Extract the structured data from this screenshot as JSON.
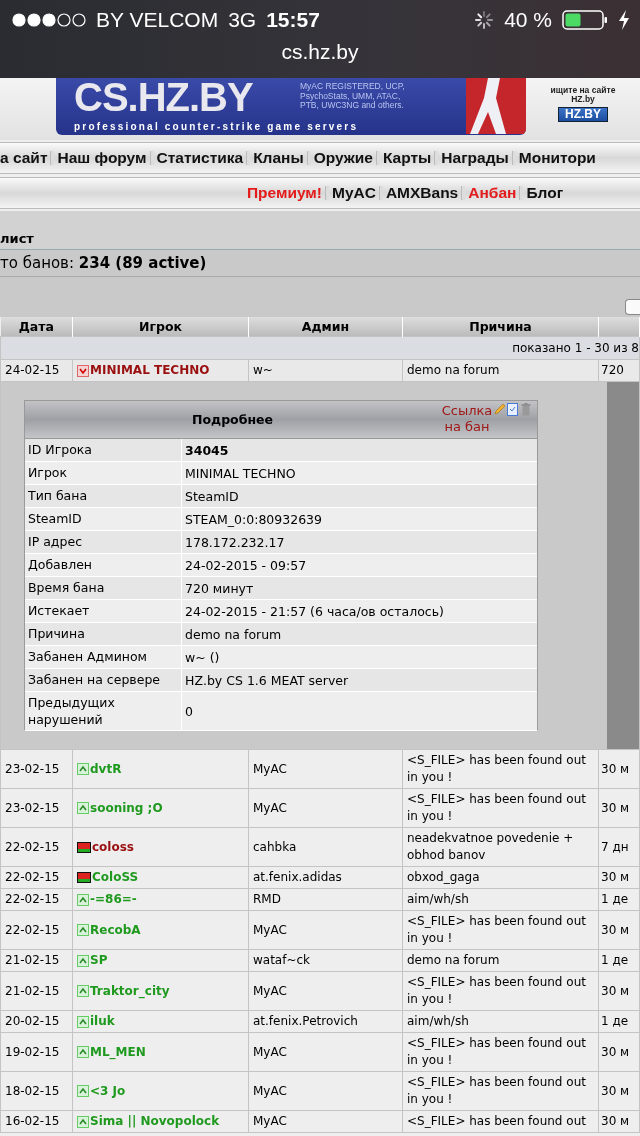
{
  "status_bar": {
    "carrier": "BY VELCOM",
    "network": "3G",
    "time": "15:57",
    "battery": "40 %"
  },
  "address_bar": {
    "url": "cs.hz.by"
  },
  "banner": {
    "logo": "CS.HZ.BY",
    "features": [
      "MyAC REGISTERED, UCP,",
      "PsychoStats, UMM, ATAC,",
      "PTB, UWC3NG and others."
    ],
    "slogan": "professional counter-strike game servers",
    "side_text": [
      "ищите на сайте",
      "HZ.by"
    ],
    "side_logo": "HZ.BY"
  },
  "main_menu": [
    {
      "label": "а сайт"
    },
    {
      "label": "Наш форум"
    },
    {
      "label": "Статистика"
    },
    {
      "label": "Кланы"
    },
    {
      "label": "Оружие"
    },
    {
      "label": "Карты"
    },
    {
      "label": "Награды"
    },
    {
      "label": "Монитори"
    }
  ],
  "sub_menu": [
    {
      "label": "Премиум!",
      "color": "#e31b1b"
    },
    {
      "label": "MyAC",
      "color": "#111111"
    },
    {
      "label": "AMXBans",
      "color": "#111111"
    },
    {
      "label": "Анбан",
      "color": "#e31b1b"
    },
    {
      "label": "Блог",
      "color": "#111111"
    }
  ],
  "section": {
    "title": "лист",
    "total": "то банов: **234 (89 active)**"
  },
  "table": {
    "columns": [
      "Дата",
      "Игрок",
      "Админ",
      "Причина"
    ],
    "pagination": "показано 1 - 30 из 8",
    "rows": [
      {
        "date": "24-02-15",
        "kind": "arrow",
        "player": "MINIMAL TECHNO",
        "color": "#9a1010",
        "admin": "w~",
        "reason": "demo na forum",
        "length": "720",
        "expanded": true
      },
      {
        "date": "23-02-15",
        "kind": "arrow",
        "player": "dvtR",
        "color": "#1f9a1f",
        "admin": "MyAC",
        "reason": "<S_FILE> has been found out in you !",
        "length": "30 м",
        "expanded": false
      },
      {
        "date": "23-02-15",
        "kind": "arrow",
        "player": "sooning ;O",
        "color": "#1f9a1f",
        "admin": "MyAC",
        "reason": "<S_FILE> has been found out in you !",
        "length": "30 м",
        "expanded": false
      },
      {
        "date": "22-02-15",
        "kind": "flag",
        "player": "coloss",
        "color": "#9a1010",
        "admin": "cahbka",
        "reason": "neadekvatnoe povedenie + obhod banov",
        "length": "7 дн"
      },
      {
        "date": "22-02-15",
        "kind": "flag",
        "player": "ColoSS",
        "color": "#1f9a1f",
        "admin": "at.fenix.adidas",
        "reason": "obxod_gaga",
        "length": "30 м"
      },
      {
        "date": "22-02-15",
        "kind": "arrow",
        "player": "-=86=-",
        "color": "#1f9a1f",
        "admin": "RMD",
        "reason": "aim/wh/sh",
        "length": "1 де",
        "expanded": false
      },
      {
        "date": "22-02-15",
        "kind": "arrow",
        "player": "RecobA",
        "color": "#1f9a1f",
        "admin": "MyAC",
        "reason": "<S_FILE> has been found out in you !",
        "length": "30 м",
        "expanded": false
      },
      {
        "date": "21-02-15",
        "kind": "arrow",
        "player": "SP",
        "color": "#1f9a1f",
        "admin": "wataf~ck",
        "reason": "demo na forum",
        "length": "1 де",
        "expanded": false
      },
      {
        "date": "21-02-15",
        "kind": "arrow",
        "player": "Traktor_city",
        "color": "#1f9a1f",
        "admin": "MyAC",
        "reason": "<S_FILE> has been found out in you !",
        "length": "30 м",
        "expanded": false
      },
      {
        "date": "20-02-15",
        "kind": "arrow",
        "player": "iluk",
        "color": "#1f9a1f",
        "admin": "at.fenix.Petrovich",
        "reason": "aim/wh/sh",
        "length": "1 де",
        "expanded": false
      },
      {
        "date": "19-02-15",
        "kind": "arrow",
        "player": "ML_MEN",
        "color": "#1f9a1f",
        "admin": "MyAC",
        "reason": "<S_FILE> has been found out in you !",
        "length": "30 м",
        "expanded": false
      },
      {
        "date": "18-02-15",
        "kind": "arrow",
        "player": "<3 Jo",
        "color": "#1f9a1f",
        "admin": "MyAC",
        "reason": "<S_FILE> has been found out in you !",
        "length": "30 м",
        "expanded": false
      },
      {
        "date": "16-02-15",
        "kind": "arrow",
        "player": "Sima || Novopolock",
        "color": "#1f9a1f",
        "admin": "MyAC",
        "reason": "<S_FILE> has been found out",
        "length": "30 м",
        "expanded": false
      }
    ]
  },
  "details": {
    "title": "Подробнее",
    "link": "Ссылка на бан",
    "fields": [
      {
        "label": "ID Игрока",
        "value": "34045",
        "strong": true
      },
      {
        "label": "Игрок",
        "value": "MINIMAL TECHNO",
        "strong": false
      },
      {
        "label": "Тип бана",
        "value": "SteamID",
        "strong": false
      },
      {
        "label": "SteamID",
        "value": "STEAM_0:0:80932639",
        "strong": false
      },
      {
        "label": "IP адрес",
        "value": "178.172.232.17",
        "strong": false
      },
      {
        "label": "Добавлен",
        "value": "24-02-2015 - 09:57",
        "strong": false
      },
      {
        "label": "Время бана",
        "value": "720  минут",
        "strong": false
      },
      {
        "label": "Истекает",
        "value": "24-02-2015 - 21:57  (6 часа/ов  осталось)",
        "strong": false
      },
      {
        "label": "Причина",
        "value": "demo na forum",
        "strong": false
      },
      {
        "label": "Забанен Админом",
        "value": "w~ ()",
        "strong": false
      },
      {
        "label": "Забанен на сервере",
        "value": "HZ.by CS 1.6 MEAT server",
        "strong": false
      },
      {
        "label": "Предыдущих нарушений",
        "value": "0",
        "strong": false
      }
    ]
  }
}
